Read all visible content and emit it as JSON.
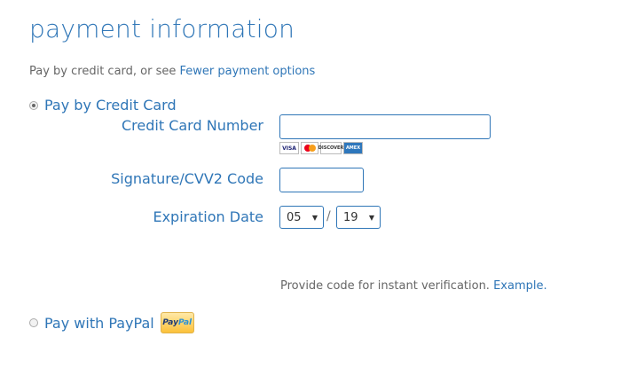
{
  "page": {
    "title": "payment information",
    "subtitle_prefix": "Pay by credit card, or see",
    "subtitle_link": "Fewer payment options"
  },
  "credit_card_option": {
    "label": "Pay by Credit Card",
    "selected": true
  },
  "form": {
    "card_number_label": "Credit Card Number",
    "card_number_value": "",
    "cvv_label": "Signature/CVV2 Code",
    "cvv_value": "",
    "expiration_label": "Expiration Date",
    "expiration_month": "05",
    "expiration_separator": "/",
    "expiration_year": "19"
  },
  "card_logos": {
    "visa": "VISA",
    "discover": "DISCOVER",
    "amex": "AMEX"
  },
  "hint": {
    "text": "Provide code for instant verification.",
    "link": "Example."
  },
  "paypal_option": {
    "label": "Pay with PayPal",
    "selected": false,
    "badge_part1": "Pay",
    "badge_part2": "Pal"
  }
}
